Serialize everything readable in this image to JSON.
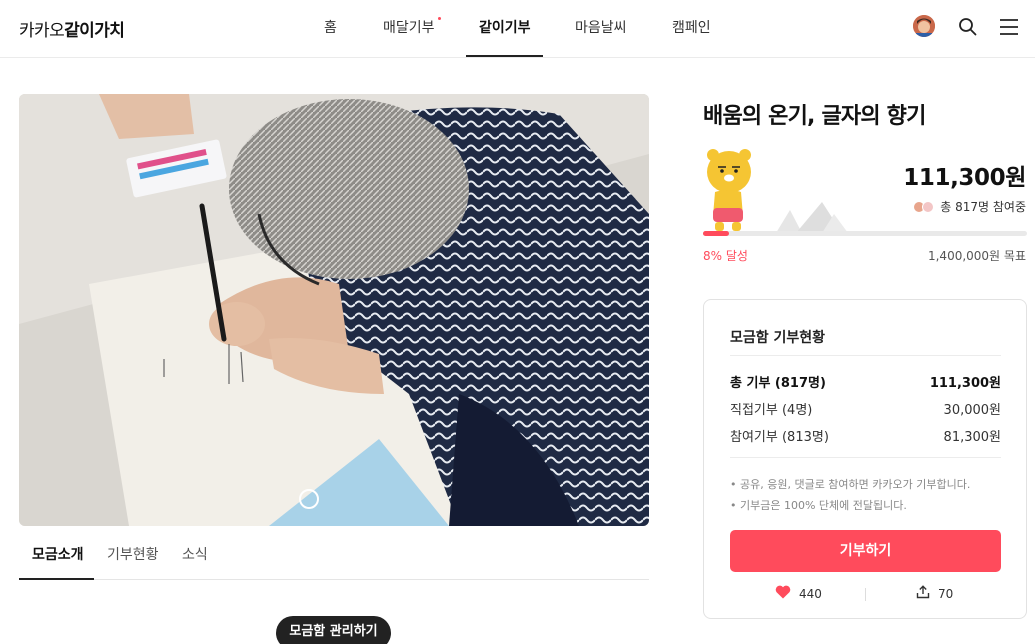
{
  "header": {
    "logo_light": "카카오",
    "logo_bold": "같이가치",
    "nav": [
      {
        "label": "홈"
      },
      {
        "label": "매달기부"
      },
      {
        "label": "같이기부"
      },
      {
        "label": "마음날씨"
      },
      {
        "label": "캠페인"
      }
    ],
    "active_nav": "같이기부"
  },
  "tabs": [
    {
      "label": "모금소개"
    },
    {
      "label": "기부현황"
    },
    {
      "label": "소식"
    }
  ],
  "manage_button": "모금함 관리하기",
  "fundraiser": {
    "title": "배움의 온기, 글자의 향기",
    "amount": "111,300원",
    "participants": "총 817명 참여중",
    "progress_percent": 8,
    "progress_label": "8% 달성",
    "goal": "1,400,000원 목표"
  },
  "summary_card": {
    "title": "모금함 기부현황",
    "rows": [
      {
        "label": "총 기부 (817명)",
        "value": "111,300원"
      },
      {
        "label": "직접기부 (4명)",
        "value": "30,000원"
      },
      {
        "label": "참여기부 (813명)",
        "value": "81,300원"
      }
    ],
    "notes": [
      "• 공유, 응원, 댓글로 참여하면 카카오가 기부합니다.",
      "• 기부금은 100% 단체에 전달됩니다."
    ],
    "donate_button": "기부하기",
    "likes": "440",
    "shares": "70"
  },
  "colors": {
    "accent": "#ff4b5c",
    "text": "#222222",
    "border": "#e2e2e2"
  },
  "icons": [
    "search-icon",
    "menu-icon",
    "heart-icon",
    "share-icon"
  ]
}
